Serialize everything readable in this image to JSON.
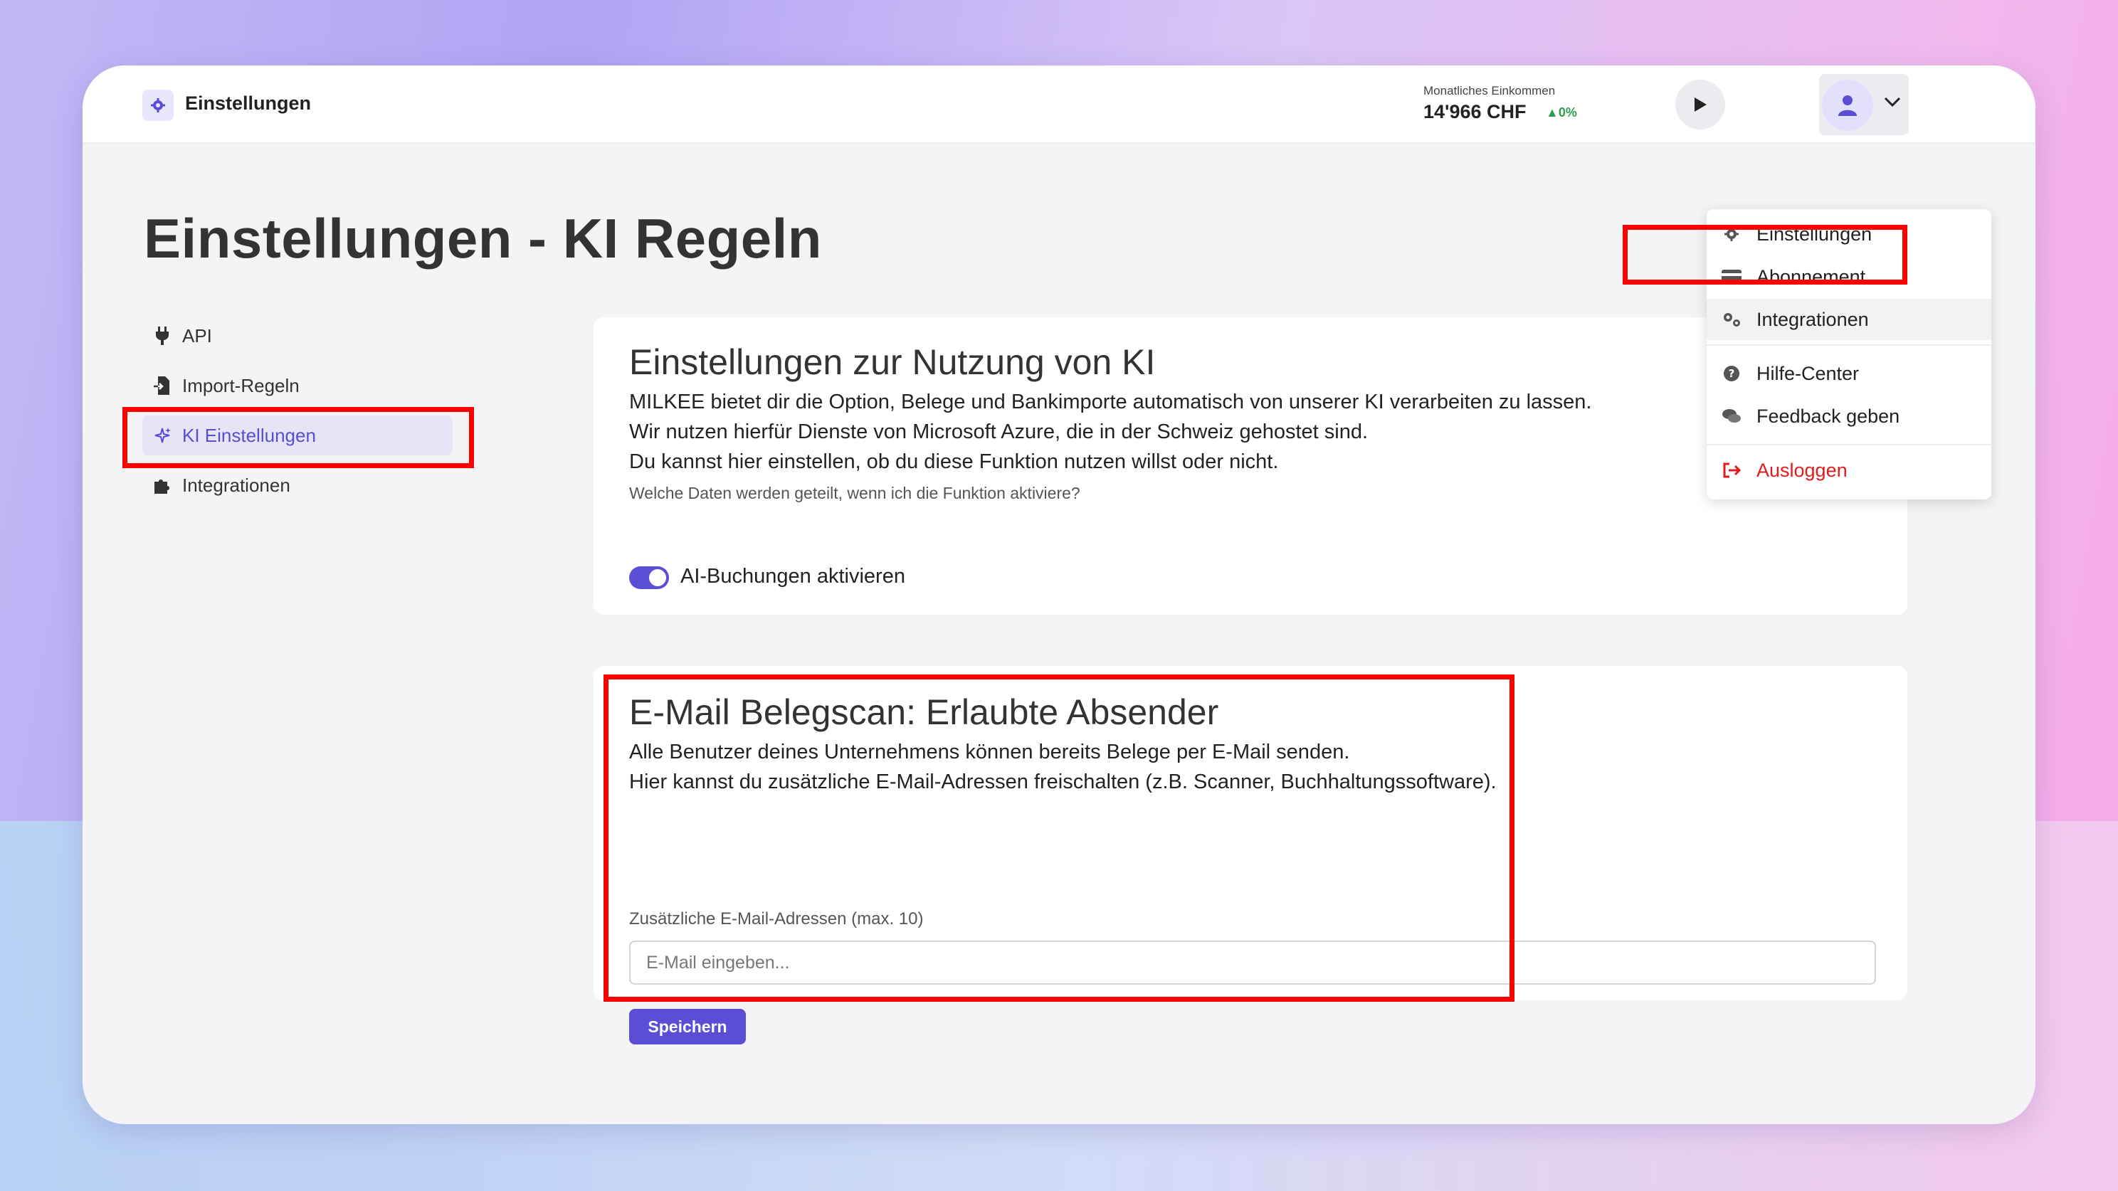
{
  "header": {
    "app_title": "Einstellungen",
    "income_label": "Monatliches Einkommen",
    "income_value": "14'966 CHF",
    "income_change": "0%"
  },
  "page": {
    "title": "Einstellungen - KI Regeln"
  },
  "sidebar": {
    "items": [
      {
        "label": "API",
        "icon": "plug-icon"
      },
      {
        "label": "Import-Regeln",
        "icon": "file-import-icon"
      },
      {
        "label": "KI Einstellungen",
        "icon": "sparkle-icon",
        "active": true
      },
      {
        "label": "Integrationen",
        "icon": "puzzle-icon"
      }
    ]
  },
  "ai_card": {
    "title": "Einstellungen zur Nutzung von KI",
    "line1": "MILKEE bietet dir die Option, Belege und Bankimporte automatisch von unserer KI verarbeiten zu lassen.",
    "line2": "Wir nutzen hierfür Dienste von Microsoft Azure, die in der Schweiz gehostet sind.",
    "line3": "Du kannst hier einstellen, ob du diese Funktion nutzen willst oder nicht.",
    "info_link": "Welche Daten werden geteilt, wenn ich die Funktion aktiviere?",
    "toggle_label": "AI-Buchungen aktivieren",
    "toggle_on": true
  },
  "email_card": {
    "title": "E-Mail Belegscan: Erlaubte Absender",
    "line1": "Alle Benutzer deines Unternehmens können bereits Belege per E-Mail senden.",
    "line2": "Hier kannst du zusätzliche E-Mail-Adressen freischalten (z.B. Scanner, Buchhaltungssoftware).",
    "field_label": "Zusätzliche E-Mail-Adressen (max. 10)",
    "placeholder": "E-Mail eingeben...",
    "save_label": "Speichern"
  },
  "user_menu": {
    "items": [
      {
        "label": "Einstellungen",
        "icon": "gear-icon"
      },
      {
        "label": "Abonnement",
        "icon": "credit-card-icon"
      },
      {
        "label": "Integrationen",
        "icon": "gears-icon"
      },
      {
        "label": "Hilfe-Center",
        "icon": "question-circle-icon"
      },
      {
        "label": "Feedback geben",
        "icon": "comments-icon"
      },
      {
        "label": "Ausloggen",
        "icon": "logout-icon"
      }
    ]
  },
  "colors": {
    "accent": "#5b4dd4",
    "danger": "#e01b1b",
    "highlight": "#ff0000",
    "positive": "#2e9e4f"
  }
}
